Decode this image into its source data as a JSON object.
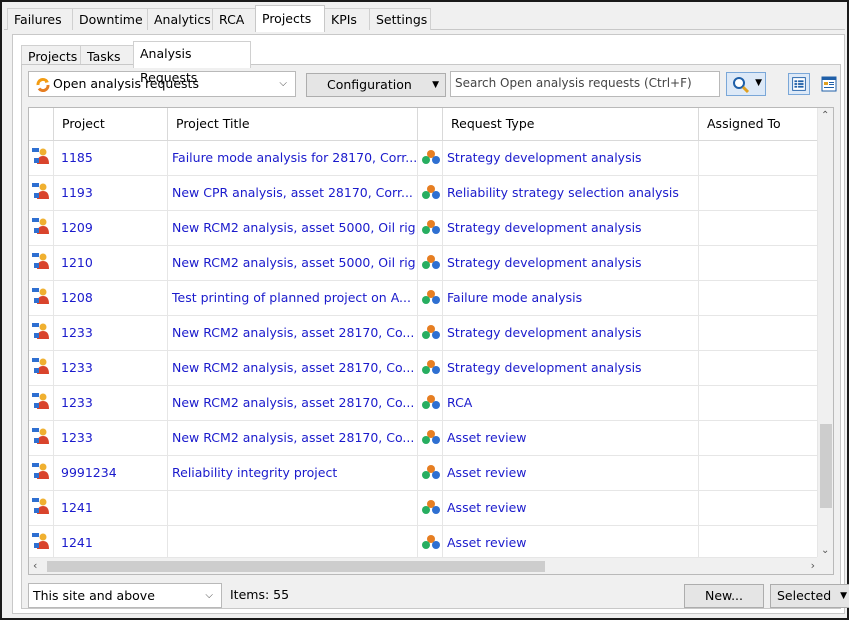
{
  "top_tabs": [
    {
      "label": "Failures"
    },
    {
      "label": "Downtime"
    },
    {
      "label": "Analytics"
    },
    {
      "label": "RCA"
    },
    {
      "label": "Projects"
    },
    {
      "label": "KPIs"
    },
    {
      "label": "Settings"
    }
  ],
  "active_top_tab": "Projects",
  "sub_tabs": [
    {
      "label": "Projects"
    },
    {
      "label": "Tasks"
    },
    {
      "label": "Analysis Requests"
    }
  ],
  "active_sub_tab": "Analysis Requests",
  "toolbar": {
    "filter_value": "Open analysis requests",
    "configuration_label": "Configuration",
    "search_placeholder": "Search Open analysis requests  (Ctrl+F)"
  },
  "grid": {
    "columns": [
      "Project",
      "Project Title",
      "Request Type",
      "Assigned To"
    ],
    "rows": [
      {
        "project": "1185",
        "title": "Failure mode analysis for 28170, Corr...",
        "type": "Strategy development analysis",
        "assigned": ""
      },
      {
        "project": "1193",
        "title": "New CPR analysis, asset 28170, Corr...",
        "type": "Reliability strategy selection analysis",
        "assigned": ""
      },
      {
        "project": "1209",
        "title": "New RCM2 analysis, asset 5000, Oil rig",
        "type": "Strategy development analysis",
        "assigned": ""
      },
      {
        "project": "1210",
        "title": "New RCM2 analysis, asset 5000, Oil rig",
        "type": "Strategy development analysis",
        "assigned": ""
      },
      {
        "project": "1208",
        "title": "Test printing of planned project on  A...",
        "type": "Failure mode analysis",
        "assigned": ""
      },
      {
        "project": "1233",
        "title": "New RCM2 analysis, asset 28170, Co...",
        "type": "Strategy development analysis",
        "assigned": ""
      },
      {
        "project": "1233",
        "title": "New RCM2 analysis, asset 28170, Co...",
        "type": "Strategy development analysis",
        "assigned": ""
      },
      {
        "project": "1233",
        "title": "New RCM2 analysis, asset 28170, Co...",
        "type": "RCA",
        "assigned": ""
      },
      {
        "project": "1233",
        "title": "New RCM2 analysis, asset 28170, Co...",
        "type": "Asset review",
        "assigned": ""
      },
      {
        "project": "9991234",
        "title": "Reliability integrity project",
        "type": "Asset review",
        "assigned": ""
      },
      {
        "project": "1241",
        "title": "",
        "type": "Asset review",
        "assigned": ""
      },
      {
        "project": "1241",
        "title": "",
        "type": "Asset review",
        "assigned": ""
      }
    ]
  },
  "footer": {
    "scope_value": "This site and above",
    "items_label": "Items: 55",
    "new_label": "New...",
    "selected_label": "Selected"
  },
  "colors": {
    "link_text": "#1a1acc",
    "selected_button_bg": "#dde9f7",
    "selected_button_border": "#7aa7d8"
  },
  "icons": {
    "row": "project-person-icon",
    "request": "analysis-request-icon",
    "filter": "refresh-arrows-icon",
    "search": "magnifier-icon"
  }
}
